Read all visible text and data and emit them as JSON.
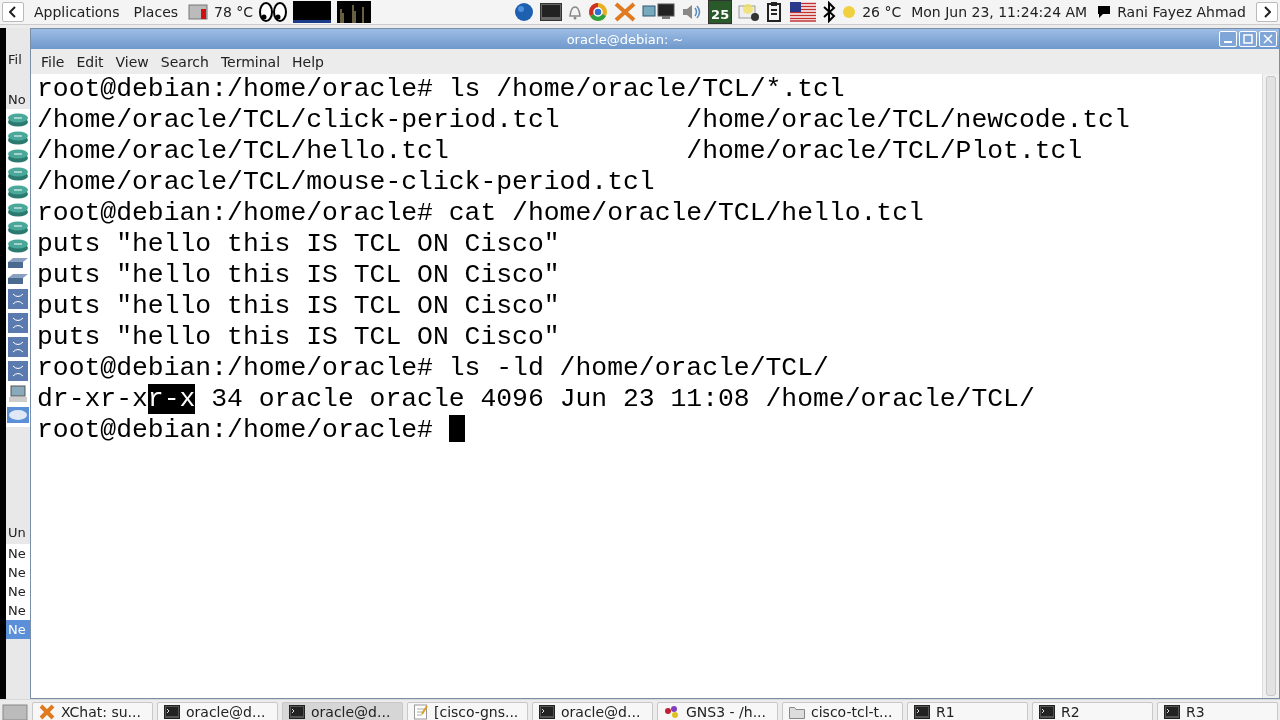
{
  "top_panel": {
    "applications": "Applications",
    "places": "Places",
    "cpu_temperature": "78 °C",
    "calendar_day": "25",
    "weather": "26 °C",
    "clock": "Mon Jun 23, 11:24:24 AM",
    "user": "Rani Fayez Ahmad"
  },
  "background_window": {
    "menu": "Fil",
    "nodes_header": "No",
    "undo_header": "Un",
    "undo_items": [
      {
        "label": "Ne",
        "selected": false
      },
      {
        "label": "Ne",
        "selected": false
      },
      {
        "label": "Ne",
        "selected": false
      },
      {
        "label": "Ne",
        "selected": false
      },
      {
        "label": "Ne",
        "selected": true
      }
    ]
  },
  "terminal": {
    "title": "oracle@debian: ~",
    "menu": [
      "File",
      "Edit",
      "View",
      "Search",
      "Terminal",
      "Help"
    ],
    "lines": [
      {
        "kind": "prompt",
        "prompt": "root@debian:/home/oracle#",
        "command": "ls /home/oracle/TCL/*.tcl"
      },
      {
        "kind": "columns",
        "cells": [
          "/home/oracle/TCL/click-period.tcl",
          "/home/oracle/TCL/newcode.tcl"
        ]
      },
      {
        "kind": "columns",
        "cells": [
          "/home/oracle/TCL/hello.tcl",
          "/home/oracle/TCL/Plot.tcl"
        ]
      },
      {
        "kind": "columns",
        "cells": [
          "/home/oracle/TCL/mouse-click-period.tcl"
        ]
      },
      {
        "kind": "prompt",
        "prompt": "root@debian:/home/oracle#",
        "command": "cat /home/oracle/TCL/hello.tcl"
      },
      {
        "kind": "output",
        "parts": [
          {
            "text": "puts \"hello this IS TCL ON Cisco\"",
            "selected": false
          }
        ]
      },
      {
        "kind": "output",
        "parts": [
          {
            "text": "puts \"hello this IS TCL ON Cisco\"",
            "selected": false
          }
        ]
      },
      {
        "kind": "output",
        "parts": [
          {
            "text": "puts \"hello this IS TCL ON Cisco\"",
            "selected": false
          }
        ]
      },
      {
        "kind": "output",
        "parts": [
          {
            "text": "puts \"hello this IS TCL ON Cisco\"",
            "selected": false
          }
        ]
      },
      {
        "kind": "prompt",
        "prompt": "root@debian:/home/oracle#",
        "command": "ls -ld /home/oracle/TCL/"
      },
      {
        "kind": "output",
        "parts": [
          {
            "text": "dr-xr-x",
            "selected": false
          },
          {
            "text": "r-x",
            "selected": true
          },
          {
            "text": " 34 oracle oracle 4096 Jun 23 11:08 /home/oracle/TCL/",
            "selected": false
          }
        ]
      },
      {
        "kind": "prompt",
        "prompt": "root@debian:/home/oracle#",
        "cursor": true
      }
    ]
  },
  "taskbar": [
    {
      "kind": "chat",
      "label": "XChat: su...",
      "selected": false
    },
    {
      "kind": "terminal",
      "label": "oracle@d...",
      "selected": false
    },
    {
      "kind": "terminal",
      "label": "oracle@d...",
      "selected": true
    },
    {
      "kind": "editor",
      "label": "[cisco-gns...",
      "selected": false
    },
    {
      "kind": "terminal",
      "label": "oracle@d...",
      "selected": false
    },
    {
      "kind": "gns3",
      "label": "GNS3 - /h...",
      "selected": false
    },
    {
      "kind": "folder",
      "label": "cisco-tcl-t...",
      "selected": false
    },
    {
      "kind": "terminal",
      "label": "R1",
      "selected": false
    },
    {
      "kind": "terminal",
      "label": "R2",
      "selected": false
    },
    {
      "kind": "terminal",
      "label": "R3",
      "selected": false
    }
  ]
}
